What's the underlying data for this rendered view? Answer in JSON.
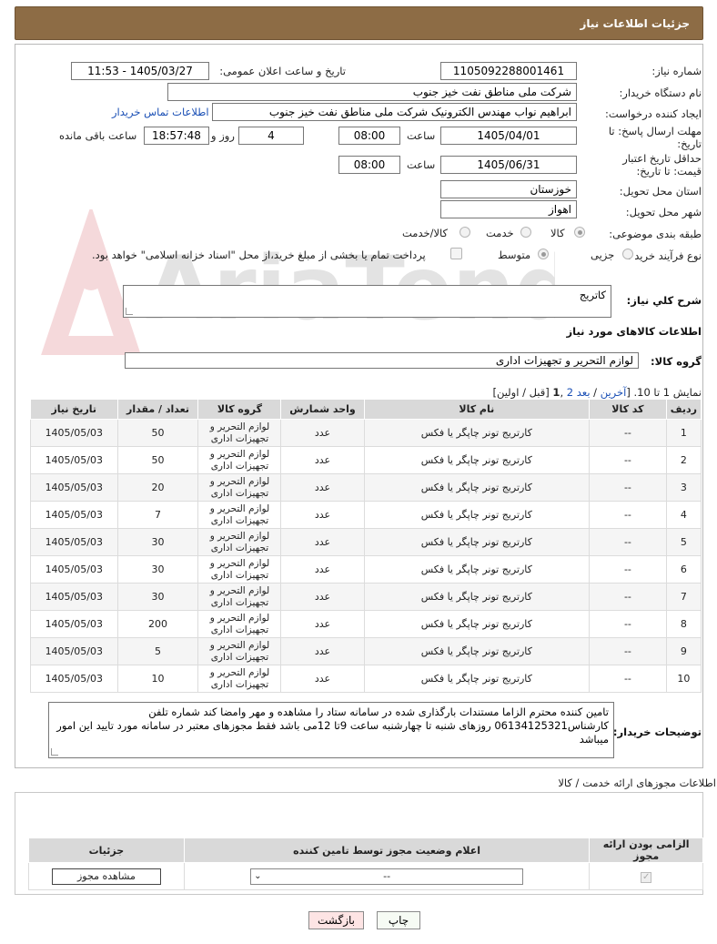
{
  "header": {
    "title": "جزئیات اطلاعات نیاز"
  },
  "fields": {
    "need_number_label": "شماره نیاز:",
    "need_number": "1105092288001461",
    "announce_label": "تاریخ و ساعت اعلان عمومی:",
    "announce_value": "1405/03/27 - 11:53",
    "buyer_org_label": "نام دستگاه خریدار:",
    "buyer_org": "شرکت ملی مناطق نفت خیز جنوب",
    "requester_label": "ایجاد کننده درخواست:",
    "requester": "ابراهیم نواب مهندس الکترونیک شرکت ملی مناطق نفت خیز جنوب",
    "buyer_contact_link": "اطلاعات تماس خریدار",
    "deadline_label": "مهلت ارسال پاسخ: تا تاریخ:",
    "deadline_date": "1405/04/01",
    "time_label": "ساعت",
    "deadline_time": "08:00",
    "days_count": "4",
    "days_label": "روز و",
    "remaining_time": "18:57:48",
    "remaining_label": "ساعت باقی مانده",
    "price_validity_label": "حداقل تاریخ اعتبار قیمت: تا تاریخ:",
    "price_validity_date": "1405/06/31",
    "price_validity_time": "08:00",
    "province_label": "استان محل تحویل:",
    "province": "خوزستان",
    "city_label": "شهر محل تحویل:",
    "city": "اهواز",
    "category_label": "طبقه بندی موضوعی:",
    "category_options": [
      "کالا",
      "خدمت",
      "کالا/خدمت"
    ],
    "category_selected": "کالا",
    "process_label": "نوع فرآیند خرید :",
    "process_options": [
      "جزیی",
      "متوسط"
    ],
    "process_selected": "متوسط",
    "payment_note": "پرداخت تمام یا بخشی از مبلغ خرید،از محل \"اسناد خزانه اسلامی\" خواهد بود."
  },
  "watermark": {
    "text": "AriaTender.neT"
  },
  "summary": {
    "label": "شرح کلي نياز:",
    "value": "کاتریج"
  },
  "goods_info": {
    "title": "اطلاعات کالاهای مورد نیاز",
    "group_label": "گروه کالا:",
    "group_value": "لوازم التحریر و تجهیزات اداری"
  },
  "pagination": {
    "prefix": "نمایش 1 تا 10. [",
    "last": "آخرین",
    "sep1": " / ",
    "next": "بعد",
    "page2": "2",
    "comma": " ,",
    "page1": "1",
    "suffix": " [قبل / اولین]"
  },
  "table": {
    "columns": [
      "ردیف",
      "کد کالا",
      "نام کالا",
      "واحد شمارش",
      "گروه کالا",
      "تعداد / مقدار",
      "تاریخ نیاز"
    ],
    "rows": [
      [
        "1",
        "--",
        "کارتریج تونر چاپگر یا فکس",
        "عدد",
        "لوازم التحریر و تجهیزات اداری",
        "50",
        "1405/05/03"
      ],
      [
        "2",
        "--",
        "کارتریج تونر چاپگر یا فکس",
        "عدد",
        "لوازم التحریر و تجهیزات اداری",
        "50",
        "1405/05/03"
      ],
      [
        "3",
        "--",
        "کارتریج تونر چاپگر یا فکس",
        "عدد",
        "لوازم التحریر و تجهیزات اداری",
        "20",
        "1405/05/03"
      ],
      [
        "4",
        "--",
        "کارتریج تونر چاپگر یا فکس",
        "عدد",
        "لوازم التحریر و تجهیزات اداری",
        "7",
        "1405/05/03"
      ],
      [
        "5",
        "--",
        "کارتریج تونر چاپگر یا فکس",
        "عدد",
        "لوازم التحریر و تجهیزات اداری",
        "30",
        "1405/05/03"
      ],
      [
        "6",
        "--",
        "کارتریج تونر چاپگر یا فکس",
        "عدد",
        "لوازم التحریر و تجهیزات اداری",
        "30",
        "1405/05/03"
      ],
      [
        "7",
        "--",
        "کارتریج تونر چاپگر یا فکس",
        "عدد",
        "لوازم التحریر و تجهیزات اداری",
        "30",
        "1405/05/03"
      ],
      [
        "8",
        "--",
        "کارتریج تونر چاپگر یا فکس",
        "عدد",
        "لوازم التحریر و تجهیزات اداری",
        "200",
        "1405/05/03"
      ],
      [
        "9",
        "--",
        "کارتریج تونر چاپگر یا فکس",
        "عدد",
        "لوازم التحریر و تجهیزات اداری",
        "5",
        "1405/05/03"
      ],
      [
        "10",
        "--",
        "کارتریج تونر چاپگر یا فکس",
        "عدد",
        "لوازم التحریر و تجهیزات اداری",
        "10",
        "1405/05/03"
      ]
    ]
  },
  "buyer_notes": {
    "label": "توضیحات خریدار:",
    "text": "تامین کننده محترم الزاما مستندات بارگذاری شده در سامانه ستاد را مشاهده و مهر وامضا کند شماره تلفن کارشناس06134125321 روزهای شنبه تا چهارشنبه ساعت 9تا 12می باشد فقط مجوزهای معتبر در سامانه مورد تایید این امور میباشد"
  },
  "permits": {
    "title": "اطلاعات مجوزهای ارائه خدمت / کالا",
    "columns": [
      "الزامی بودن ارائه مجوز",
      "اعلام وضعیت مجوز توسط تامین کننده",
      "جزئیات"
    ],
    "select_value": "--",
    "view_button": "مشاهده مجوز"
  },
  "actions": {
    "print": "چاپ",
    "back": "بازگشت"
  },
  "colors": {
    "header_bg": "#8d6c45",
    "link": "#1a4fb5",
    "back_btn_bg": "#fde4e4"
  }
}
